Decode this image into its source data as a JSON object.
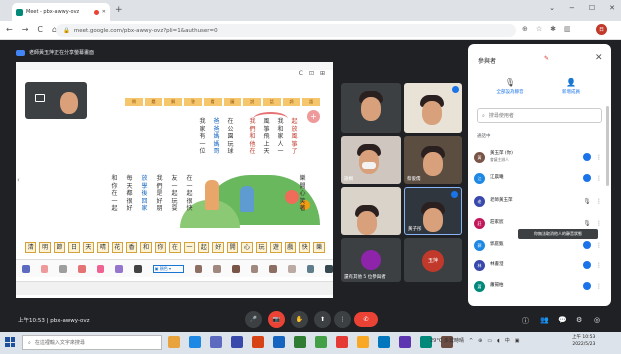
{
  "browser": {
    "tab_title": "Meet - pbx-awwy-ovz",
    "new_tab": "+",
    "window_controls": [
      "⌄",
      "−",
      "☐",
      "✕"
    ],
    "nav": [
      "←",
      "→",
      "C",
      "⌂"
    ],
    "url": "meet.google.com/pbx-awwy-ovz?pli=1&authuser=0",
    "ext_icons": [
      "⊕",
      "☆",
      "✱",
      "▥"
    ],
    "avatar_initial": "日"
  },
  "meet": {
    "presenting_label": "老師黃玉萍正在分享螢幕畫面",
    "self_icon": "□",
    "meeting_time": "上午10:53",
    "meeting_code": "pbx-awwy-ovz",
    "separator": "|",
    "end_call_icon": "✆",
    "controls": [
      "🎤",
      "📷",
      "✋",
      "⬆",
      "⋮"
    ],
    "right_controls": [
      "ⓘ",
      "👥",
      "💬",
      "⚙",
      "◎"
    ]
  },
  "slide": {
    "top_icons": [
      "C",
      "⊡",
      "⊞"
    ],
    "yellow_band": [
      "問",
      "題",
      "解",
      "答",
      "看",
      "圖",
      "說",
      "話",
      "詞",
      "語"
    ],
    "columns": [
      {
        "chars": "我家有一位",
        "color": "dark"
      },
      {
        "chars": "爸爸媽媽哥",
        "color": "blue"
      },
      {
        "chars": "在公園玩球",
        "color": "dark"
      },
      {
        "chars": "我們和他在",
        "color": "red"
      },
      {
        "chars": "風箏飛上天",
        "color": "dark"
      },
      {
        "chars": "我和家人一",
        "color": "dark"
      },
      {
        "chars": "起放風箏了",
        "color": "red"
      },
      {
        "chars": "和你在一起",
        "color": "dark"
      },
      {
        "chars": "每天都很好",
        "color": "dark"
      },
      {
        "chars": "放學後回家",
        "color": "blue"
      },
      {
        "chars": "我們是好朋",
        "color": "dark"
      },
      {
        "chars": "友一起玩耍",
        "color": "dark"
      },
      {
        "chars": "在一起很快",
        "color": "dark"
      },
      {
        "chars": "樂開心笑著",
        "color": "dark"
      }
    ],
    "side_arrow": "‹",
    "pink_ball": "+",
    "bottom_row": [
      "清",
      "明",
      "節",
      "日",
      "天",
      "晴",
      "花",
      "香",
      "和",
      "你",
      "在",
      "一",
      "起",
      "好",
      "開",
      "心",
      "玩",
      "遊",
      "戲",
      "快",
      "樂"
    ],
    "toolbar_select": "▣ 顏色 ▾"
  },
  "tiles": [
    {
      "name": "",
      "kind": "child"
    },
    {
      "name": "",
      "kind": "child"
    },
    {
      "name": "語桐",
      "kind": "child-mask"
    },
    {
      "name": "蔡俊儒",
      "kind": "child"
    },
    {
      "name": "",
      "kind": "child"
    },
    {
      "name": "黃子彤",
      "kind": "child"
    },
    {
      "name": "還有其他 5 位參與者",
      "kind": "group"
    },
    {
      "name": "玉萍",
      "kind": "teacher"
    }
  ],
  "panel": {
    "title": "參與者",
    "close": "✕",
    "pen_icon": "✎",
    "mute_all": "全部設為靜音",
    "add_people": "新增成員",
    "search_placeholder": "搜尋使用者",
    "section_label": "通話中",
    "tooltip": "你無法取消他人的靜音狀態",
    "people": [
      {
        "name": "黃玉萍 (你)",
        "sub": "會議主辦人",
        "color": "#795548",
        "initial": "黃",
        "state": "speaking"
      },
      {
        "name": "江晨曦",
        "sub": "",
        "color": "#1e88e5",
        "initial": "江",
        "state": "speaking"
      },
      {
        "name": "老師黃玉萍",
        "sub": "",
        "color": "#3949ab",
        "initial": "老",
        "state": "muted"
      },
      {
        "name": "莊家宸",
        "sub": "",
        "color": "#c2185b",
        "initial": "莊",
        "state": "muted"
      },
      {
        "name": "郭庭甄",
        "sub": "",
        "color": "#1e88e5",
        "initial": "郭",
        "state": "speaking"
      },
      {
        "name": "林書澄",
        "sub": "",
        "color": "#3949ab",
        "initial": "林",
        "state": "speaking"
      },
      {
        "name": "蕭揚柏",
        "sub": "",
        "color": "#00897b",
        "initial": "蕭",
        "state": "speaking"
      }
    ]
  },
  "taskbar": {
    "search_placeholder": "在這裡輸入文字來搜尋",
    "app_colors": [
      "#e8a33d",
      "#1e88e5",
      "#5c6bc0",
      "#3949ab",
      "#d84315",
      "#1565c0",
      "#2e7d32",
      "#43a047",
      "#e53935",
      "#f9a825",
      "#0277bd",
      "#5e35b1",
      "#00897b",
      "#6d4c41"
    ],
    "weather": "29°C 多雲時晴",
    "tray": [
      "^",
      "⊕",
      "▭",
      "◖",
      "中",
      "▣"
    ],
    "time": "上午 10:53",
    "date": "2022/5/23"
  }
}
